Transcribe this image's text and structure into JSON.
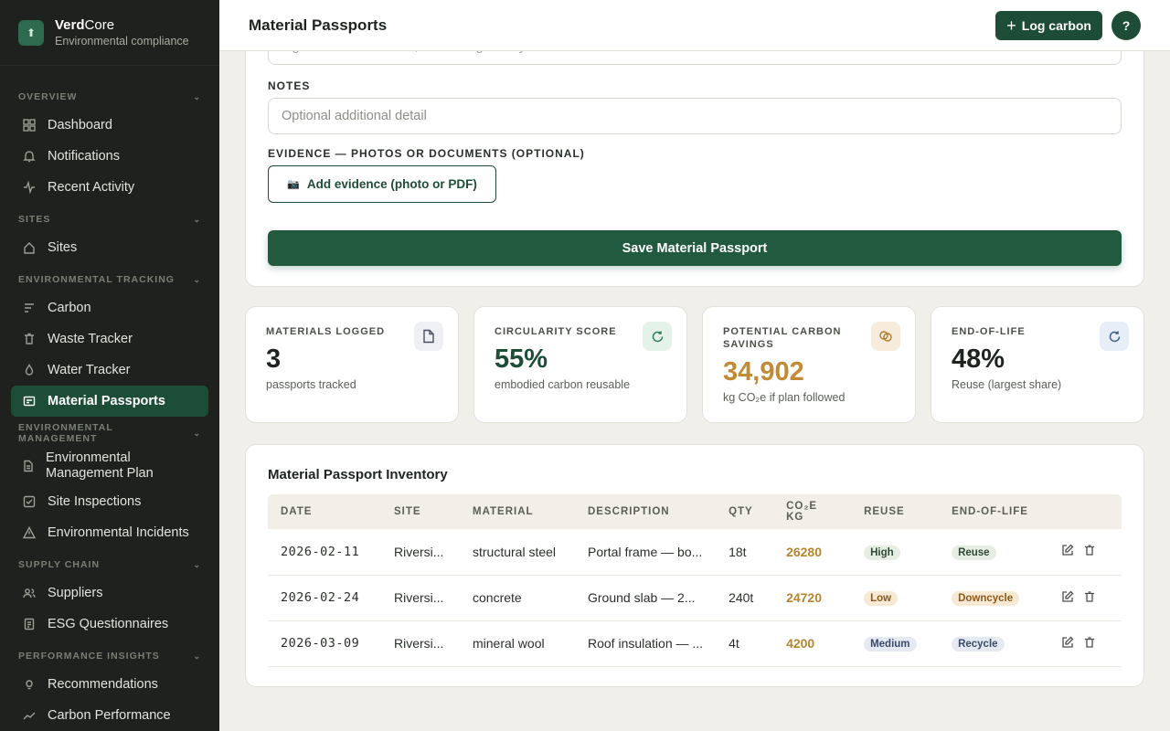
{
  "brand": {
    "name_bold": "Verd",
    "name_light": "Core",
    "subtitle": "Environmental compliance"
  },
  "nav": {
    "overview": {
      "label": "OVERVIEW",
      "items": [
        {
          "label": "Dashboard"
        },
        {
          "label": "Notifications"
        },
        {
          "label": "Recent Activity"
        }
      ]
    },
    "sites": {
      "label": "SITES",
      "items": [
        {
          "label": "Sites"
        }
      ]
    },
    "tracking": {
      "label": "ENVIRONMENTAL TRACKING",
      "items": [
        {
          "label": "Carbon"
        },
        {
          "label": "Waste Tracker"
        },
        {
          "label": "Water Tracker"
        },
        {
          "label": "Material Passports"
        }
      ]
    },
    "management": {
      "label": "ENVIRONMENTAL MANAGEMENT",
      "items": [
        {
          "label": "Environmental Management Plan"
        },
        {
          "label": "Site Inspections"
        },
        {
          "label": "Environmental Incidents"
        }
      ]
    },
    "supply": {
      "label": "SUPPLY CHAIN",
      "items": [
        {
          "label": "Suppliers"
        },
        {
          "label": "ESG Questionnaires"
        }
      ]
    },
    "performance": {
      "label": "PERFORMANCE INSIGHTS",
      "items": [
        {
          "label": "Recommendations"
        },
        {
          "label": "Carbon Performance"
        }
      ]
    }
  },
  "header": {
    "title": "Material Passports",
    "log_label": "Log carbon",
    "help_label": "?"
  },
  "form": {
    "prev_input_placeholder": "e.g. Bolted connections, no welding — fully demountable",
    "notes_label": "NOTES",
    "notes_placeholder": "Optional additional detail",
    "evidence_label": "EVIDENCE — PHOTOS OR DOCUMENTS (OPTIONAL)",
    "evidence_button": "Add evidence (photo or PDF)",
    "save_button": "Save Material Passport"
  },
  "stats": [
    {
      "label": "MATERIALS LOGGED",
      "value": "3",
      "sub": "passports tracked",
      "color": "#1f2420",
      "icon": "document-icon",
      "icon_bg": "#eef0f4"
    },
    {
      "label": "CIRCULARITY SCORE",
      "value": "55%",
      "sub": "embodied carbon reusable",
      "color": "#1d4d36",
      "icon": "refresh-icon",
      "icon_bg": "#e5f2ea"
    },
    {
      "label": "POTENTIAL CARBON SAVINGS",
      "value": "34,902",
      "sub": "kg CO₂e if plan followed",
      "color": "#c38a35",
      "icon": "coins-icon",
      "icon_bg": "#f7ecdc"
    },
    {
      "label": "END-OF-LIFE",
      "value": "48%",
      "sub": "Reuse (largest share)",
      "color": "#1f2420",
      "icon": "refresh-icon",
      "icon_bg": "#e8eef8"
    }
  ],
  "inventory": {
    "title": "Material Passport Inventory",
    "columns": [
      "DATE",
      "SITE",
      "MATERIAL",
      "DESCRIPTION",
      "QTY",
      "CO₂E KG",
      "REUSE",
      "END-OF-LIFE",
      ""
    ],
    "rows": [
      {
        "date": "2026-02-11",
        "site": "Riversi...",
        "material": "structural steel",
        "description": "Portal frame — bo...",
        "qty": "18t",
        "co2": "26280",
        "reuse": "High",
        "eol": "Reuse"
      },
      {
        "date": "2026-02-24",
        "site": "Riversi...",
        "material": "concrete",
        "description": "Ground slab — 2...",
        "qty": "240t",
        "co2": "24720",
        "reuse": "Low",
        "eol": "Downcycle"
      },
      {
        "date": "2026-03-09",
        "site": "Riversi...",
        "material": "mineral wool",
        "description": "Roof insulation — ...",
        "qty": "4t",
        "co2": "4200",
        "reuse": "Medium",
        "eol": "Recycle"
      }
    ]
  },
  "colors": {
    "accent": "#1d4d36",
    "sidebar_bg": "#1e211d",
    "co2_value": "#b7842e"
  }
}
